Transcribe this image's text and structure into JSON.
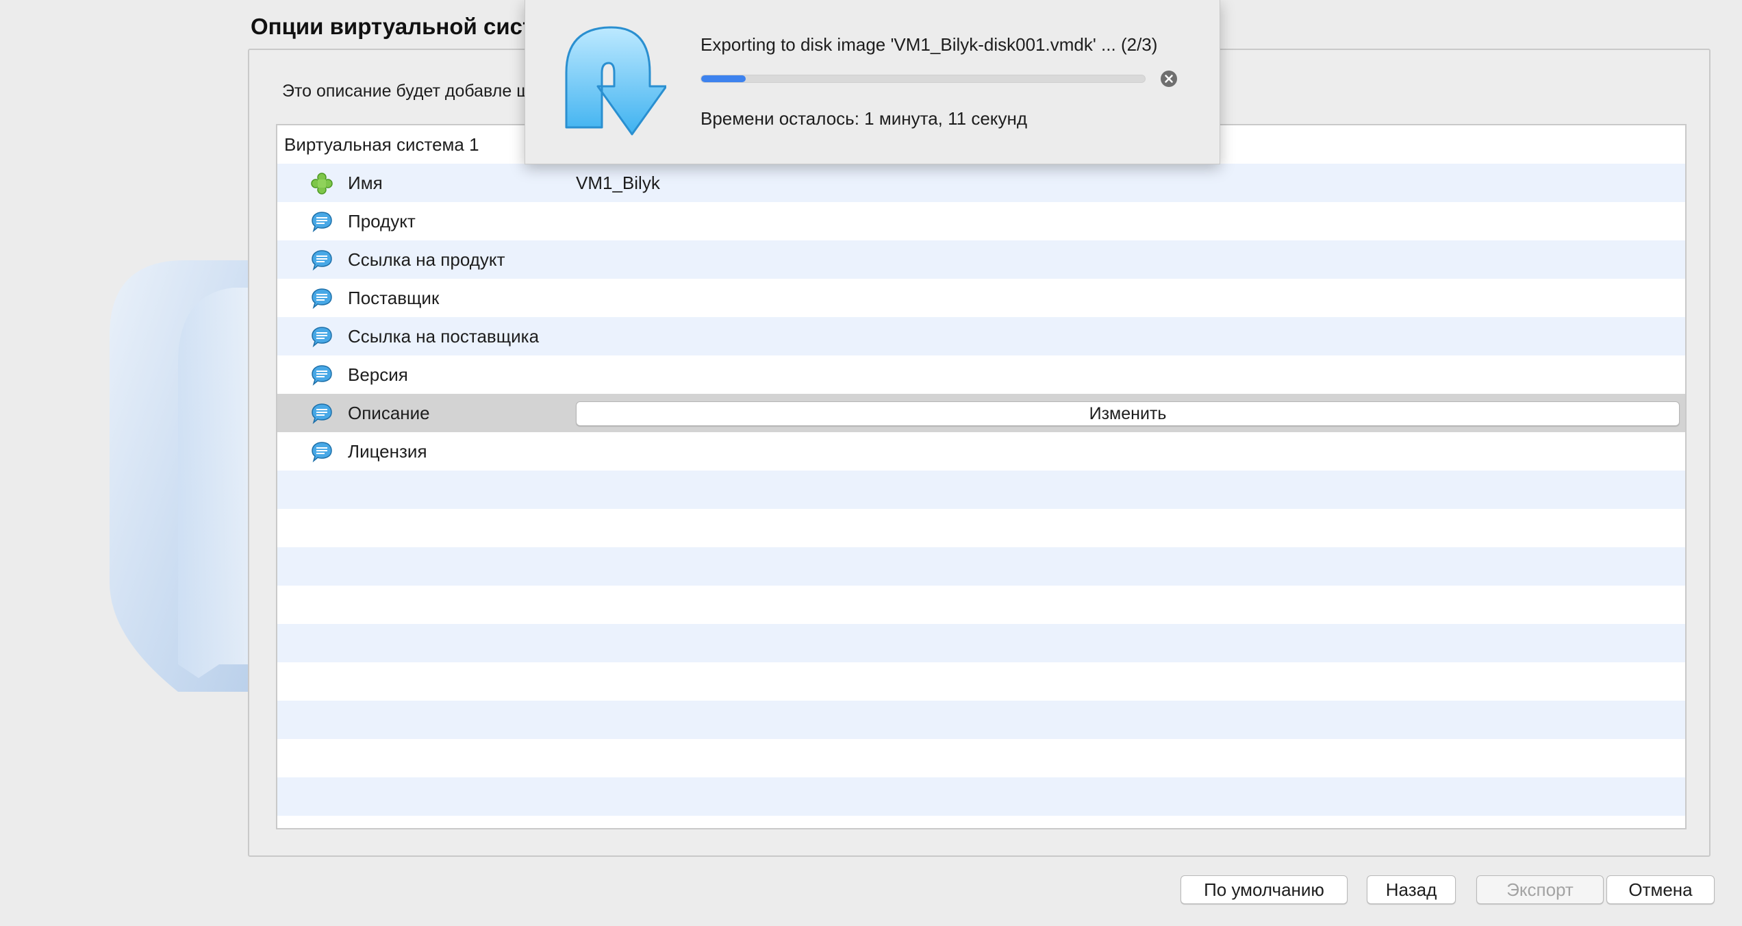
{
  "page": {
    "title": "Опции виртуальной сист",
    "description": "Это описание будет добавле                                                                                                  щелчком мыши."
  },
  "tree": {
    "root_label": "Виртуальная система 1",
    "rows": [
      {
        "label": "Имя",
        "value": "VM1_Bilyk",
        "icon": "puzzle-icon"
      },
      {
        "label": "Продукт",
        "value": "",
        "icon": "speech-bubble-icon"
      },
      {
        "label": "Ссылка на продукт",
        "value": "",
        "icon": "speech-bubble-icon"
      },
      {
        "label": "Поставщик",
        "value": "",
        "icon": "speech-bubble-icon"
      },
      {
        "label": "Ссылка на поставщика",
        "value": "",
        "icon": "speech-bubble-icon"
      },
      {
        "label": "Версия",
        "value": "",
        "icon": "speech-bubble-icon"
      },
      {
        "label": "Описание",
        "value": "",
        "icon": "speech-bubble-icon",
        "button": "Изменить"
      },
      {
        "label": "Лицензия",
        "value": "",
        "icon": "speech-bubble-icon"
      }
    ]
  },
  "progress": {
    "title": "Exporting to disk image 'VM1_Bilyk-disk001.vmdk' ... (2/3)",
    "remaining": "Времени осталось: 1 минута, 11 секунд",
    "fraction": 0.1,
    "accent_color": "#3d82ee"
  },
  "buttons": {
    "defaults": "По умолчанию",
    "back": "Назад",
    "export": "Экспорт",
    "cancel": "Отмена"
  }
}
